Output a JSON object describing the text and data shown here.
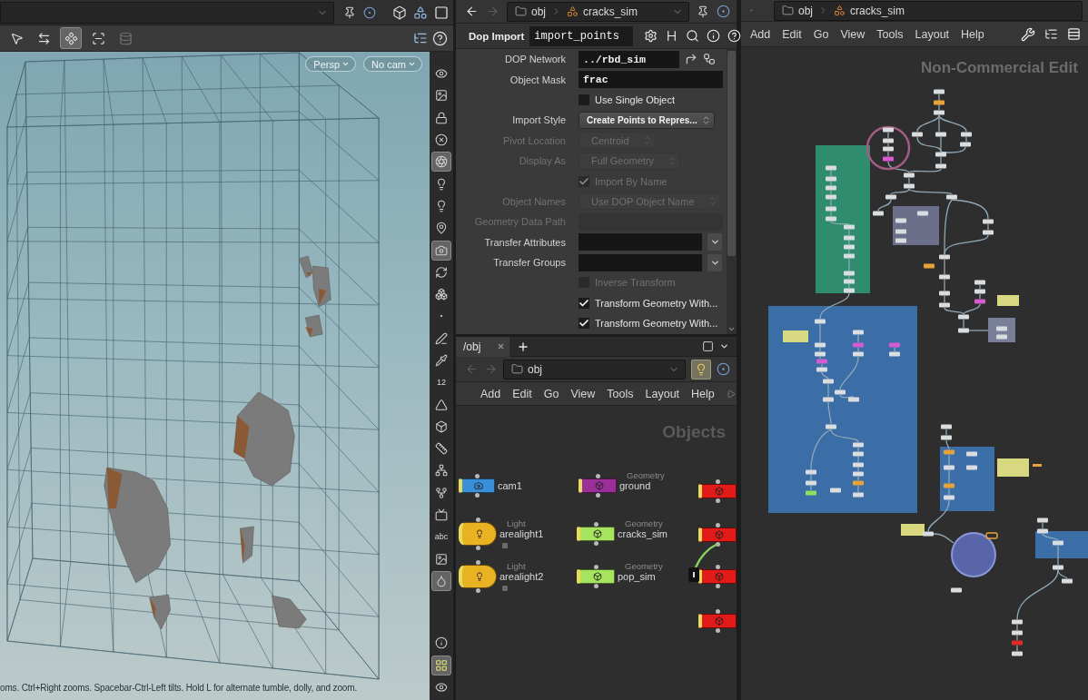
{
  "viewport": {
    "toolbar": [
      {
        "selected": false,
        "disabled": false
      },
      {
        "selected": false,
        "disabled": false
      },
      {
        "selected": true,
        "disabled": false
      },
      {
        "selected": false,
        "disabled": false
      },
      {
        "selected": false,
        "disabled": true
      }
    ],
    "view_buttons": [
      {
        "label": "Persp"
      },
      {
        "label": "No cam"
      }
    ],
    "side_tools": [
      {
        "selected": false
      },
      {
        "selected": false
      },
      {
        "selected": false
      },
      {
        "selected": false
      },
      {
        "selected": true
      },
      {
        "selected": false
      },
      {
        "selected": false
      },
      {
        "selected": false
      },
      {
        "selected": true
      },
      {
        "selected": false
      },
      {
        "selected": false
      },
      {
        "selected": false
      },
      {
        "selected": false
      },
      {
        "selected": false
      },
      {
        "label": "12",
        "selected": false
      },
      {
        "selected": false
      },
      {
        "selected": false
      },
      {
        "selected": false
      },
      {
        "selected": false
      },
      {
        "selected": false
      },
      {
        "selected": false
      },
      {
        "label": "abc",
        "selected": false
      },
      {
        "selected": false
      },
      {
        "selected": true
      },
      {
        "selected": false
      },
      {
        "selected": true
      },
      {
        "selected": false
      }
    ],
    "status": "oms. Ctrl+Right zooms. Spacebar-Ctrl-Left tilts. Hold L for alternate tumble, dolly, and zoom."
  },
  "parameters": {
    "path": [
      {
        "label": "obj"
      },
      {
        "label": "cracks_sim"
      }
    ],
    "node_type": "Dop Import",
    "node_name": "import_points",
    "rows": [
      {
        "kind": "path",
        "label": "DOP Network",
        "value": "../rbd_sim",
        "disabled": false
      },
      {
        "kind": "field",
        "label": "Object Mask",
        "value": "frac",
        "disabled": false
      },
      {
        "kind": "toggle",
        "label": "Use Single Object",
        "checked": false,
        "disabled": false
      },
      {
        "kind": "menu",
        "label": "Import Style",
        "value": "Create Points to Repres...",
        "disabled": false
      },
      {
        "kind": "menu",
        "label": "Pivot Location",
        "value": "Centroid",
        "disabled": true
      },
      {
        "kind": "menu",
        "label": "Display As",
        "value": "Full Geometry",
        "disabled": true
      },
      {
        "kind": "toggle",
        "label": "Import By Name",
        "checked": true,
        "disabled": true
      },
      {
        "kind": "menu",
        "label": "Object Names",
        "value": "Use DOP Object Name",
        "disabled": true
      },
      {
        "kind": "field",
        "label": "Geometry Data Path",
        "disabled": true
      },
      {
        "kind": "list",
        "label": "Transfer Attributes",
        "disabled": false
      },
      {
        "kind": "list",
        "label": "Transfer Groups",
        "disabled": false
      },
      {
        "kind": "toggle",
        "label": "Inverse Transform",
        "checked": false,
        "disabled": true
      },
      {
        "kind": "toggle",
        "label": "Transform Geometry With...",
        "checked": true,
        "disabled": false
      },
      {
        "kind": "toggle",
        "label": "Transform Geometry With...",
        "checked": true,
        "disabled": false
      }
    ]
  },
  "network": {
    "tabs": [
      {
        "label": "/obj",
        "selected": true
      }
    ],
    "path": "obj",
    "menu": [
      "Add",
      "Edit",
      "Go",
      "View",
      "Tools",
      "Layout",
      "Help"
    ],
    "context": "Objects",
    "nodes": [
      {
        "kind": "camera",
        "name": "cam1",
        "color": "#3a8fd9"
      },
      {
        "kind": "light",
        "type_label": "Light",
        "name": "arealight1",
        "color": "#e9b223"
      },
      {
        "kind": "light",
        "type_label": "Light",
        "name": "arealight2",
        "color": "#e9b223"
      },
      {
        "kind": "geometry",
        "type_label": "Geometry",
        "name": "ground",
        "color": "#9b309b"
      },
      {
        "kind": "geometry",
        "type_label": "Geometry",
        "name": "cracks_sim",
        "color": "#a6e35f"
      },
      {
        "kind": "geometry",
        "type_label": "Geometry",
        "name": "pop_sim",
        "color": "#a6e35f"
      },
      {
        "kind": "geometry",
        "color": "#e11a1a"
      },
      {
        "kind": "geometry",
        "color": "#e11a1a"
      },
      {
        "kind": "geometry",
        "color": "#e11a1a"
      },
      {
        "kind": "geometry",
        "color": "#e11a1a"
      }
    ]
  },
  "sop_network": {
    "path": [
      {
        "label": "obj"
      },
      {
        "label": "cracks_sim"
      }
    ],
    "menu": [
      "Add",
      "Edit",
      "Go",
      "View",
      "Tools",
      "Layout",
      "Help"
    ],
    "edition": "Non-Commercial Edit"
  }
}
